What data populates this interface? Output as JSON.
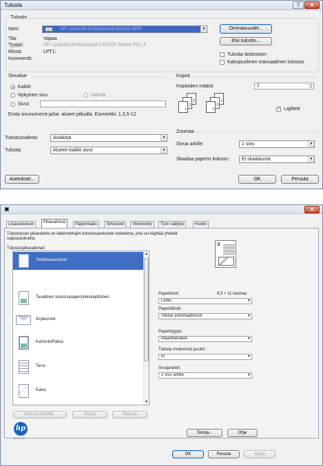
{
  "dialog1": {
    "title": "Tulosta",
    "printer_group_label": "Tulostin",
    "name_label": "Nimi:",
    "name_value": "HP LaserJet Professional M1530 MFP",
    "status_label": "Tila:",
    "status_value": "Vapaa",
    "type_label": "Tyyppi:",
    "type_value": "HP LaserJet Professional CP1025 Series PCL 6",
    "where_label": "Missä:",
    "where_value": "LPT1:",
    "comment_label": "Kommentti:",
    "properties_button": "Ominaisuudet...",
    "find_printer_button": "Etsi tulostin...",
    "print_to_file_label": "Tulosta tiedostoon",
    "duplex_label": "Kaksipuolinen manuaalinen tulostus",
    "page_range_label": "Sivualue",
    "all_label": "Kaikki",
    "current_page_label": "Nykyinen sivu",
    "selection_label": "Valinta",
    "pages_label": "Sivut:",
    "pages_hint": "Erota sivunumerot ja/tai -alueet pilkuilla. Esimerkki: 1,3,5-12",
    "copies_group_label": "Kopiot",
    "copies_count_label": "Kopioiden määrä:",
    "copies_value": "1",
    "collate_label": "Lajittele",
    "print_what_label": "Tulostusvalinta:",
    "print_what_value": "Asiakirja",
    "print_label": "Tulosta:",
    "print_value": "Alueen kaikki sivut",
    "zoom_group_label": "Zoomaa",
    "pages_per_sheet_label": "Sivua arkille:",
    "pages_per_sheet_value": "1 sivu",
    "scale_label": "Skaalaa paperin kokoon:",
    "scale_value": "Ei skaalausta",
    "options_button": "Asetukset...",
    "ok_button": "OK",
    "cancel_button": "Peruuta",
    "collate_page_numbers": [
      "1",
      "2",
      "3",
      "1",
      "2",
      "3"
    ]
  },
  "dialog2": {
    "tabs": [
      "Lisäasetukset",
      "Pikavalinnat",
      "Paperi/laatu",
      "Tehosteet",
      "Viimeistely",
      "Työn säilytys",
      "Huolto"
    ],
    "description": "Tulostuksen pikavalinta on tallennettujen tulostusasetusten kokoelma, jota voi käyttää yhdellä napsautuksella.",
    "list_label": "Tulostuspikavalinnat:",
    "shortcuts": [
      "Tehdasasetukset",
      "Tavallinen tulostuspaperi/yleiskäyttöinen",
      "Kirjekuoret",
      "Kartonki/Paksu",
      "Tarra",
      "Kalvo"
    ],
    "paper_size_label": "Paperikoot:",
    "paper_size_dim": "8,5 × 11 tuumaa",
    "paper_size_value": "Letter",
    "paper_source_label": "Paperilähde:",
    "paper_source_value": "Valitse automaattisesti",
    "paper_type_label": "Paperityyppi:",
    "paper_type_value": "Määrittämätön",
    "duplex_label": "Tulosta molemmat puolet:",
    "duplex_value": "Ei",
    "pages_per_sheet_label": "Sivuja/arkki:",
    "pages_per_sheet_value": "1 sivu arkille",
    "save_as_button": "Tallenna nimellä...",
    "delete_button": "Poista",
    "restore_button": "Palauta",
    "about_button": "Tietoja...",
    "help_button": "Ohje",
    "ok_button": "OK",
    "cancel_button": "Peruuta",
    "apply_button": "Käytä",
    "logo_text": "hp",
    "logo_tagline": "i n v e n t"
  },
  "colors": {
    "selection": "#3f6ec4",
    "accent": "#2d6fbf"
  },
  "icons": {
    "help": "question-mark-icon",
    "close": "close-x-icon"
  }
}
